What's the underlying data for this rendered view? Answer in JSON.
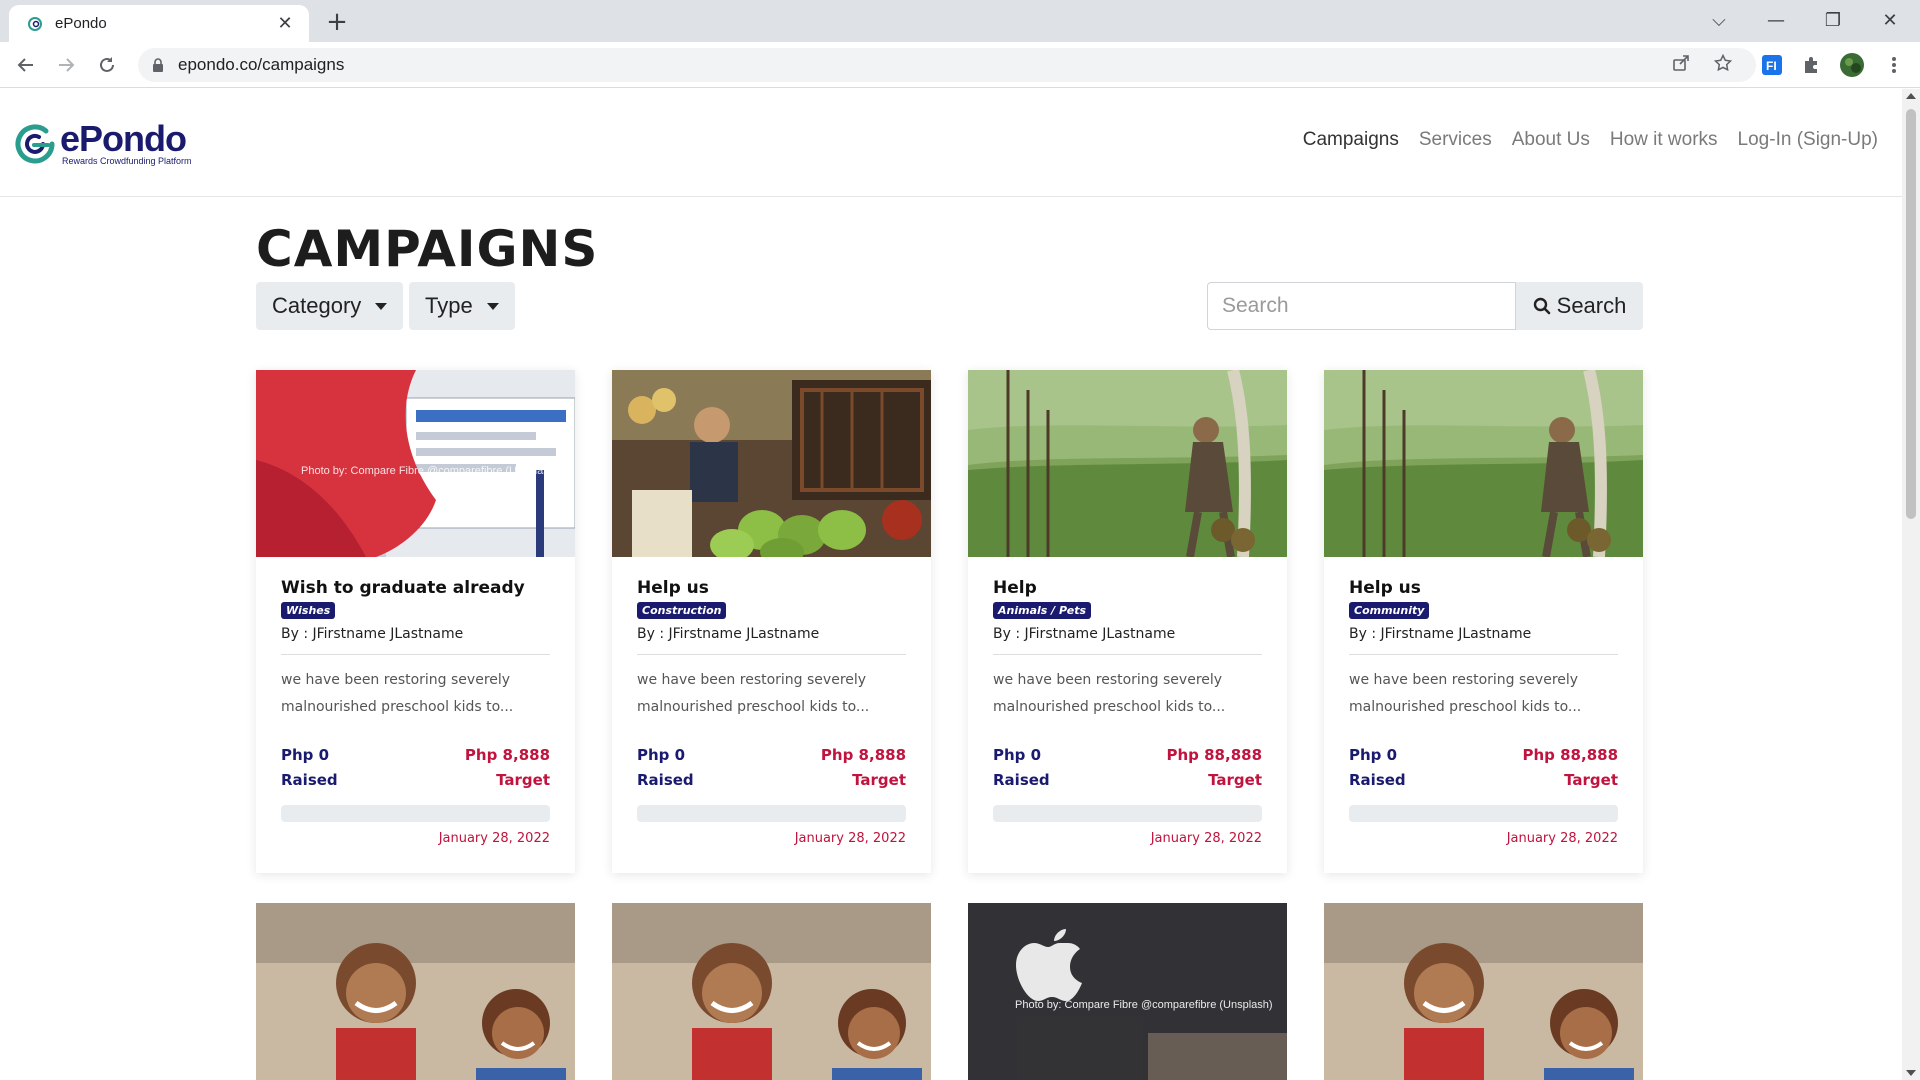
{
  "browser": {
    "tab_title": "ePondo",
    "tab_close": "✕",
    "new_tab": "+",
    "url": "epondo.co/campaigns",
    "controls": {
      "dropdown": "⌵",
      "minimize": "—",
      "restore": "❐",
      "close": "✕"
    },
    "icons": [
      "back-arrow-icon",
      "forward-arrow-icon",
      "reload-icon",
      "lock-icon",
      "share-icon",
      "star-icon",
      "extension-fi-icon",
      "puzzle-icon",
      "profile-avatar",
      "more-vert-icon"
    ]
  },
  "site": {
    "logo_name": "ePondo",
    "logo_tagline": "Rewards Crowdfunding Platform",
    "nav": [
      {
        "label": "Campaigns",
        "active": true
      },
      {
        "label": "Services",
        "active": false
      },
      {
        "label": "About Us",
        "active": false
      },
      {
        "label": "How it works",
        "active": false
      },
      {
        "label": "Log-In (Sign-Up)",
        "active": false
      }
    ],
    "colors": {
      "brand_navy": "#1a1a6e",
      "target_red": "#c0133d"
    }
  },
  "page": {
    "title": "CAMPAIGNS",
    "filters": {
      "category": "Category",
      "type": "Type"
    },
    "search": {
      "placeholder": "Search",
      "button": "Search"
    }
  },
  "campaigns": [
    {
      "title": "Wish to graduate already",
      "badge": "Wishes",
      "author": "By : JFirstname JLastname",
      "description": "we have been restoring severely malnourished preschool kids to...",
      "raised": "Php 0",
      "raised_label": "Raised",
      "target": "Php 8,888",
      "target_label": "Target",
      "progress": 0,
      "date": "January 28, 2022",
      "image_caption": "Photo by: Compare Fibre @comparefibre (Unsplash)"
    },
    {
      "title": "Help us",
      "badge": "Construction",
      "author": "By : JFirstname JLastname",
      "description": "we have been restoring severely malnourished preschool kids to...",
      "raised": "Php 0",
      "raised_label": "Raised",
      "target": "Php 8,888",
      "target_label": "Target",
      "progress": 0,
      "date": "January 28, 2022"
    },
    {
      "title": "Help",
      "badge": "Animals / Pets",
      "author": "By : JFirstname JLastname",
      "description": "we have been restoring severely malnourished preschool kids to...",
      "raised": "Php 0",
      "raised_label": "Raised",
      "target": "Php 88,888",
      "target_label": "Target",
      "progress": 0,
      "date": "January 28, 2022"
    },
    {
      "title": "Help us",
      "badge": "Community",
      "author": "By : JFirstname JLastname",
      "description": "we have been restoring severely malnourished preschool kids to...",
      "raised": "Php 0",
      "raised_label": "Raised",
      "target": "Php 88,888",
      "target_label": "Target",
      "progress": 0,
      "date": "January 28, 2022"
    }
  ],
  "second_row_caption": "Photo by: Compare Fibre @comparefibre (Unsplash)"
}
